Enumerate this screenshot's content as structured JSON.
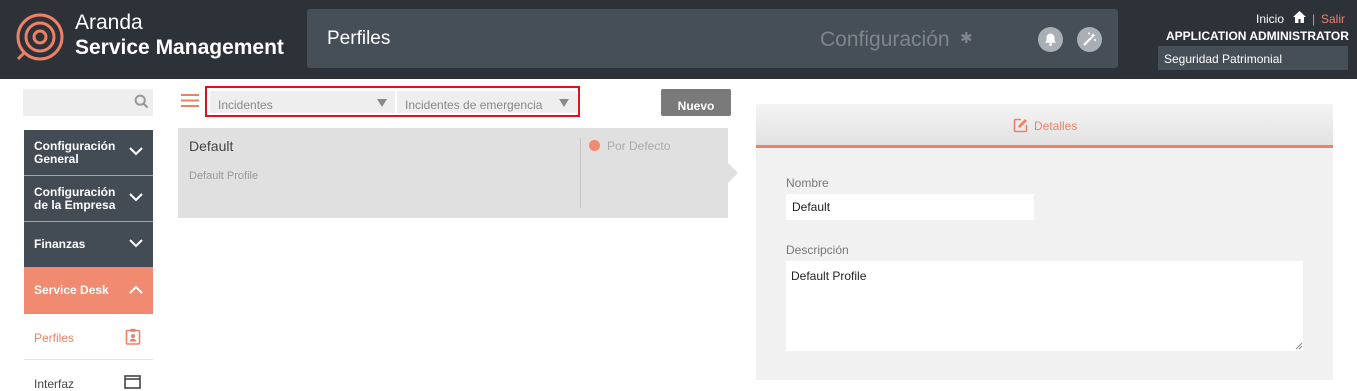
{
  "brand": {
    "line1": "Aranda",
    "line2": "Service Management"
  },
  "header": {
    "page_title": "Perfiles",
    "section": "Configuración",
    "home_link": "Inicio",
    "separator": "|",
    "logout_link": "Salir",
    "user_name": "APPLICATION ADMINISTRATOR",
    "company": "Seguridad Patrimonial"
  },
  "sidebar": {
    "search_placeholder": "",
    "items": [
      {
        "line1": "Configuración",
        "line2": "General"
      },
      {
        "line1": "Configuración",
        "line2": "de la Empresa"
      },
      {
        "line1": "Finanzas"
      },
      {
        "line1": "Service Desk"
      }
    ],
    "subitems": [
      {
        "label": "Perfiles"
      },
      {
        "label": "Interfaz"
      }
    ]
  },
  "filters": {
    "selected_1": "Incidentes",
    "selected_2": "Incidentes de emergencia",
    "new_button": "Nuevo"
  },
  "profile_card": {
    "name": "Default",
    "description": "Default Profile",
    "badge": "Por Defecto"
  },
  "details": {
    "tab_label": "Detalles",
    "name_label": "Nombre",
    "name_value": "Default",
    "description_label": "Descripción",
    "description_value": "Default Profile"
  },
  "colors": {
    "accent": "#ef8066",
    "topbar": "#2c3238",
    "sidebar": "#434b54",
    "highlight_frame": "#d9141a"
  }
}
